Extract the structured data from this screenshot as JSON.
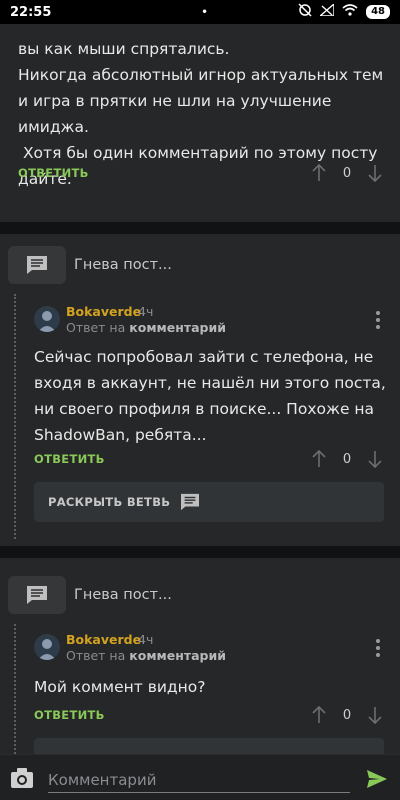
{
  "status": {
    "time": "22:55",
    "battery": "48",
    "dot": "•"
  },
  "top_comment": {
    "text": "вы как мыши спрятались.\nНикогда абсолютный игнор актуальных тем и игра в прятки не шли на улучшение имиджа.\n Хотя бы один комментарий по этому посту дайте.",
    "reply_label": "ОТВЕТИТЬ",
    "score": "0"
  },
  "threads": [
    {
      "title": "Гнева пост...",
      "comment": {
        "author": "Bokaverde",
        "time": "4ч",
        "reply_prefix": "Ответ на",
        "reply_target": "комментарий",
        "text": "Сейчас попробовал зайти с телефона, не входя в аккаунт, не нашёл ни этого поста, ни своего профиля в поиске... Похоже на ShadowBan, ребята...",
        "reply_label": "ОТВЕТИТЬ",
        "score": "0"
      },
      "expand_label": "РАСКРЫТЬ ВЕТВЬ"
    },
    {
      "title": "Гнева пост...",
      "comment": {
        "author": "Bokaverde",
        "time": "4ч",
        "reply_prefix": "Ответ на",
        "reply_target": "комментарий",
        "text": "Мой коммент видно?",
        "reply_label": "ОТВЕТИТЬ",
        "score": "0"
      }
    }
  ],
  "input": {
    "placeholder": "Комментарий"
  },
  "colors": {
    "accent_green": "#8ac858",
    "author": "#d4a21f",
    "background": "#252728"
  },
  "icons": [
    "wifi-icon",
    "signal-muted-icon",
    "thread-comment-icon",
    "up-arrow-icon",
    "down-arrow-icon",
    "more-vert-icon",
    "camera-icon",
    "send-icon"
  ]
}
